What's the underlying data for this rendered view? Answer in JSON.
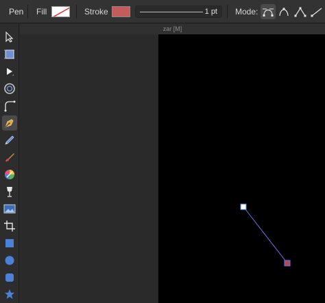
{
  "toolbar": {
    "tool_name": "Pen",
    "fill_label": "Fill",
    "stroke_label": "Stroke",
    "stroke_color": "#c45c5c",
    "stroke_width": "1 pt",
    "mode_label": "Mode:",
    "modes": [
      {
        "name": "pen-mode-icon",
        "active": true
      },
      {
        "name": "smart-mode-icon",
        "active": false
      },
      {
        "name": "polygon-mode-icon",
        "active": false
      },
      {
        "name": "line-mode-icon",
        "active": false
      }
    ]
  },
  "tools": [
    {
      "name": "move-tool-icon",
      "active": false
    },
    {
      "name": "artboard-tool-icon",
      "active": false
    },
    {
      "name": "node-tool-icon",
      "active": false
    },
    {
      "name": "contour-tool-icon",
      "active": false
    },
    {
      "name": "corner-tool-icon",
      "active": false
    },
    {
      "name": "pen-tool-icon",
      "active": true
    },
    {
      "name": "pencil-tool-icon",
      "active": false
    },
    {
      "name": "vector-brush-tool-icon",
      "active": false
    },
    {
      "name": "fill-tool-icon",
      "active": false
    },
    {
      "name": "transparency-tool-icon",
      "active": false
    },
    {
      "name": "place-image-tool-icon",
      "active": false
    },
    {
      "name": "crop-tool-icon",
      "active": false
    },
    {
      "name": "rectangle-tool-icon",
      "active": false
    },
    {
      "name": "ellipse-tool-icon",
      "active": false
    },
    {
      "name": "rounded-rectangle-tool-icon",
      "active": false
    },
    {
      "name": "star-tool-icon",
      "active": false
    }
  ],
  "document": {
    "title": "zar [M]"
  },
  "colors": {
    "path_line": "#6f74e6",
    "end_node": "#b24a5a",
    "canvas": "#000000"
  }
}
